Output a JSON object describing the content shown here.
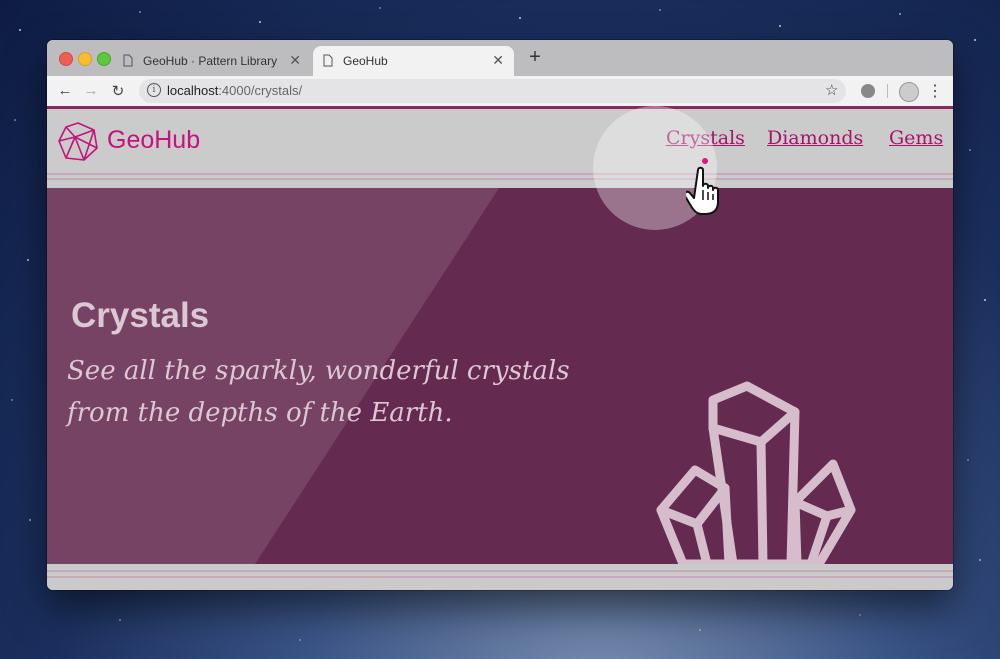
{
  "browser": {
    "tabs": [
      {
        "label": "GeoHub · Pattern Library",
        "active": false
      },
      {
        "label": "GeoHub",
        "active": true
      }
    ],
    "new_tab_symbol": "+",
    "url_host": "localhost",
    "url_path": ":4000/crystals/",
    "icons": {
      "back": "arrow-left-icon",
      "forward": "arrow-right-icon",
      "reload": "reload-icon",
      "info": "info-icon",
      "bookmark": "star-icon",
      "extension": "extension-icon",
      "profile": "profile-avatar-icon",
      "menu": "more-vertical-icon"
    }
  },
  "site": {
    "brand": "GeoHub",
    "nav": [
      "Crystals",
      "Diamonds",
      "Gems"
    ],
    "active_nav": "Crystals",
    "hero": {
      "title": "Crystals",
      "subtitle": "See all the sparkly, wonderful crystals from the depths of the Earth."
    }
  },
  "colors": {
    "brand": "#c4137b",
    "nav_link": "#a8126a",
    "hero_bg": "#652a4f",
    "hero_text": "#dcc7d4",
    "header_bg": "#cbcbcb"
  }
}
